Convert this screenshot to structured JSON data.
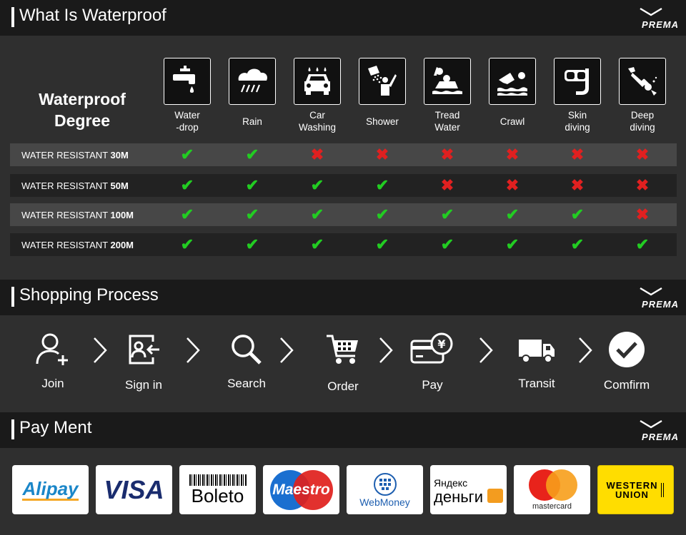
{
  "brand": "PREMA",
  "waterproof": {
    "title": "What Is Waterproof",
    "degree_label": "Waterproof\nDegree",
    "activities": [
      {
        "label": "Water\n-drop",
        "icon": "faucet-icon"
      },
      {
        "label": "Rain",
        "icon": "rain-icon"
      },
      {
        "label": "Car\nWashing",
        "icon": "car-wash-icon"
      },
      {
        "label": "Shower",
        "icon": "shower-icon"
      },
      {
        "label": "Tread\nWater",
        "icon": "tread-water-icon"
      },
      {
        "label": "Crawl",
        "icon": "swim-icon"
      },
      {
        "label": "Skin\ndiving",
        "icon": "snorkel-icon"
      },
      {
        "label": "Deep\ndiving",
        "icon": "diver-icon"
      }
    ],
    "rows": [
      {
        "prefix": "WATER RESISTANT ",
        "rating": "30M",
        "support": [
          true,
          true,
          false,
          false,
          false,
          false,
          false,
          false
        ]
      },
      {
        "prefix": "WATER RESISTANT ",
        "rating": "50M",
        "support": [
          true,
          true,
          true,
          true,
          false,
          false,
          false,
          false
        ]
      },
      {
        "prefix": "WATER RESISTANT ",
        "rating": "100M",
        "support": [
          true,
          true,
          true,
          true,
          true,
          true,
          true,
          false
        ]
      },
      {
        "prefix": "WATER RESISTANT ",
        "rating": "200M",
        "support": [
          true,
          true,
          true,
          true,
          true,
          true,
          true,
          true
        ]
      }
    ],
    "check_color": "#22cc22",
    "cross_color": "#e02020"
  },
  "shopping": {
    "title": "Shopping Process",
    "steps": [
      {
        "label": "Join",
        "icon": "add-user-icon"
      },
      {
        "label": "Sign in",
        "icon": "sign-in-icon"
      },
      {
        "label": "Search",
        "icon": "search-icon"
      },
      {
        "label": "Order",
        "icon": "cart-icon"
      },
      {
        "label": "Pay",
        "icon": "card-payment-icon"
      },
      {
        "label": "Transit",
        "icon": "truck-icon"
      },
      {
        "label": "Comfirm",
        "icon": "check-circle-icon"
      }
    ]
  },
  "payment": {
    "title": "Pay Ment",
    "methods": [
      {
        "name": "Alipay"
      },
      {
        "name": "VISA"
      },
      {
        "name": "Boleto"
      },
      {
        "name": "Maestro"
      },
      {
        "name": "WebMoney"
      },
      {
        "name": "Яндекс",
        "name2": "деньги"
      },
      {
        "name": "mastercard"
      },
      {
        "name": "WESTERN",
        "name2": "UNION"
      }
    ]
  }
}
